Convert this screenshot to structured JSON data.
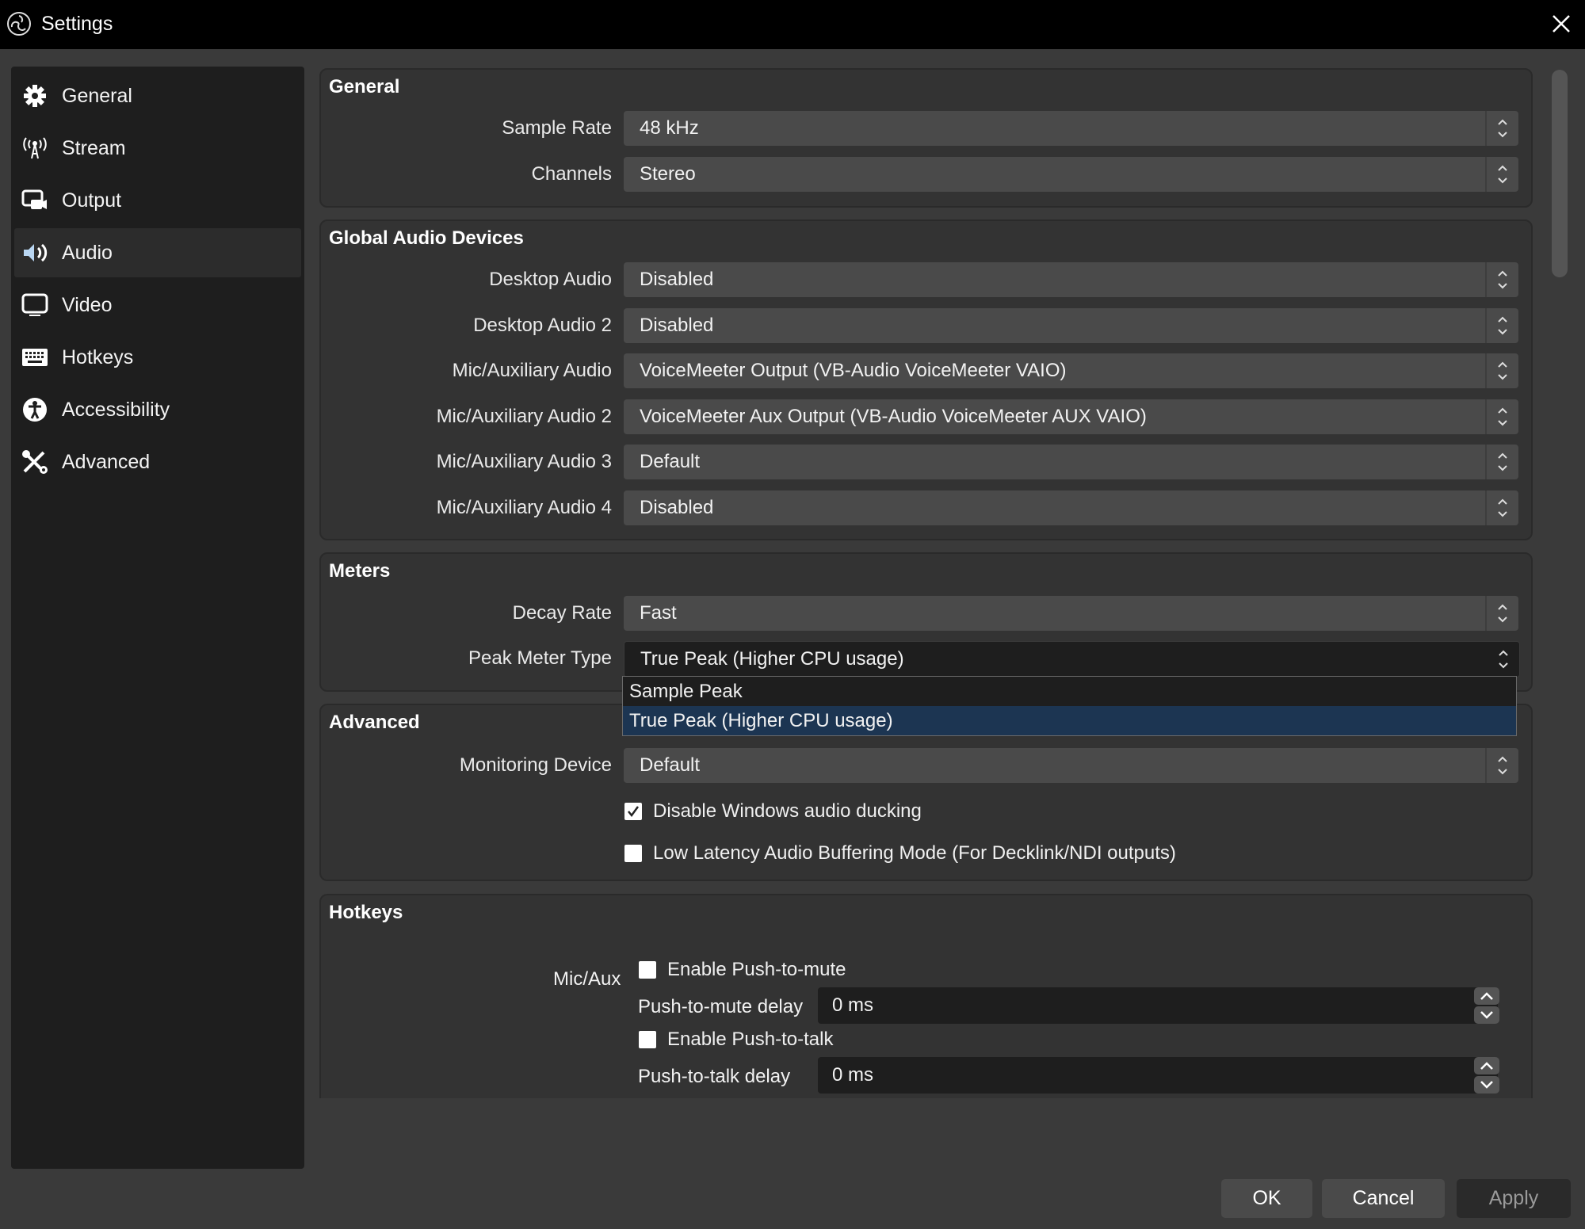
{
  "window": {
    "title": "Settings",
    "close_label": "×"
  },
  "sidebar": {
    "active": "Audio",
    "items": [
      {
        "label": "General",
        "icon": "gear-icon"
      },
      {
        "label": "Stream",
        "icon": "antenna-icon"
      },
      {
        "label": "Output",
        "icon": "output-icon"
      },
      {
        "label": "Audio",
        "icon": "speaker-icon"
      },
      {
        "label": "Video",
        "icon": "monitor-icon"
      },
      {
        "label": "Hotkeys",
        "icon": "keyboard-icon"
      },
      {
        "label": "Accessibility",
        "icon": "accessibility-icon"
      },
      {
        "label": "Advanced",
        "icon": "tools-icon"
      }
    ]
  },
  "general": {
    "title": "General",
    "rows": [
      {
        "label": "Sample Rate",
        "value": "48 kHz"
      },
      {
        "label": "Channels",
        "value": "Stereo"
      }
    ]
  },
  "global_audio": {
    "title": "Global Audio Devices",
    "rows": [
      {
        "label": "Desktop Audio",
        "value": "Disabled"
      },
      {
        "label": "Desktop Audio 2",
        "value": "Disabled"
      },
      {
        "label": "Mic/Auxiliary Audio",
        "value": "VoiceMeeter Output (VB-Audio VoiceMeeter VAIO)"
      },
      {
        "label": "Mic/Auxiliary Audio 2",
        "value": "VoiceMeeter Aux Output (VB-Audio VoiceMeeter AUX VAIO)"
      },
      {
        "label": "Mic/Auxiliary Audio 3",
        "value": "Default"
      },
      {
        "label": "Mic/Auxiliary Audio 4",
        "value": "Disabled"
      }
    ]
  },
  "meters": {
    "title": "Meters",
    "rows": [
      {
        "label": "Decay Rate",
        "value": "Fast"
      },
      {
        "label": "Peak Meter Type",
        "value": "True Peak (Higher CPU usage)"
      }
    ],
    "dropdown_options": [
      {
        "label": "Sample Peak",
        "selected": false
      },
      {
        "label": "True Peak (Higher CPU usage)",
        "selected": true
      }
    ]
  },
  "advanced": {
    "title": "Advanced",
    "monitoring_label": "Monitoring Device",
    "monitoring_value": "Default",
    "checkboxes": [
      {
        "label": "Disable Windows audio ducking",
        "checked": true
      },
      {
        "label": "Low Latency Audio Buffering Mode (For Decklink/NDI outputs)",
        "checked": false
      }
    ]
  },
  "hotkeys": {
    "title": "Hotkeys",
    "source_label": "Mic/Aux",
    "push_to_mute": {
      "label": "Enable Push-to-mute",
      "checked": false
    },
    "push_to_mute_delay": {
      "label": "Push-to-mute delay",
      "value": "0 ms"
    },
    "push_to_talk": {
      "label": "Enable Push-to-talk",
      "checked": false
    },
    "push_to_talk_delay": {
      "label": "Push-to-talk delay",
      "value": "0 ms"
    }
  },
  "footer": {
    "ok": "OK",
    "cancel": "Cancel",
    "apply": "Apply"
  },
  "colors": {
    "titlebar": "#000000",
    "background": "#3a3a3a",
    "sidebar": "#1e1e1e",
    "selection": "#1c3552",
    "combo": "#4a4a4a"
  }
}
